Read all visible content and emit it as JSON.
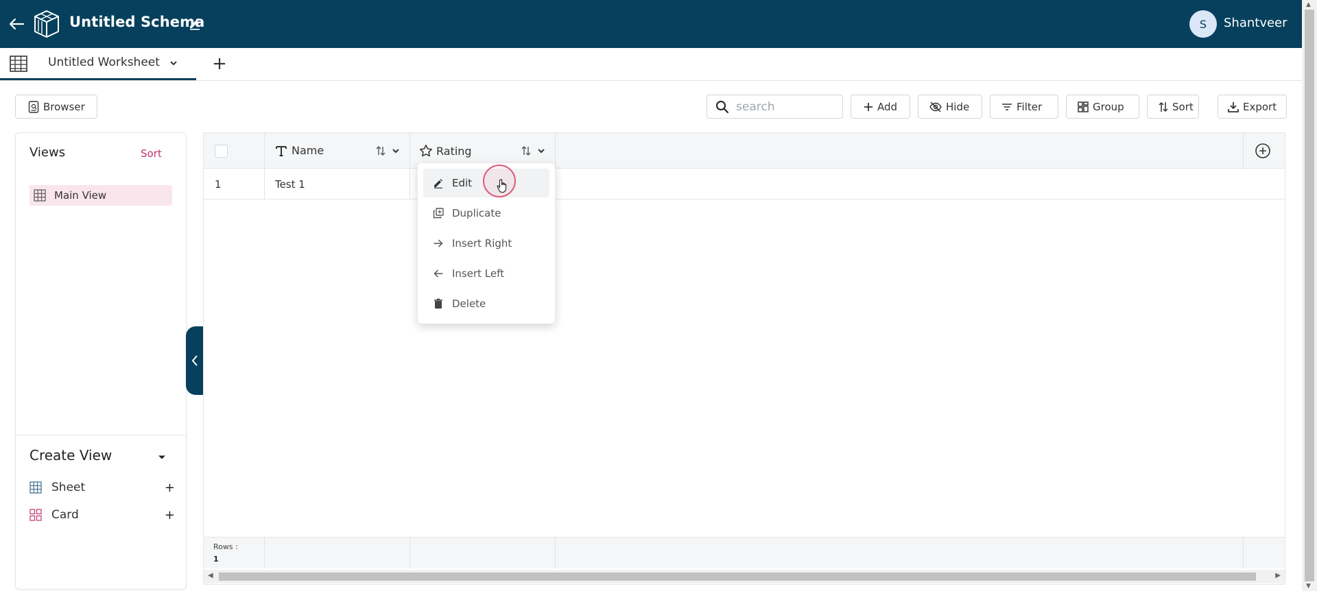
{
  "header": {
    "title": "Untitled Schema",
    "user_initial": "S",
    "user_name": "Shantveer"
  },
  "tabs": [
    {
      "label": "Untitled Worksheet"
    }
  ],
  "toolbar": {
    "browser_label": "Browser",
    "search_placeholder": "search",
    "add_label": "Add",
    "hide_label": "Hide",
    "filter_label": "Filter",
    "group_label": "Group",
    "sort_label": "Sort",
    "export_label": "Export"
  },
  "views_panel": {
    "title": "Views",
    "sort_label": "Sort",
    "items": [
      {
        "label": "Main View"
      }
    ],
    "create_view_title": "Create View",
    "create_options": [
      {
        "label": "Sheet",
        "icon": "grid-icon"
      },
      {
        "label": "Card",
        "icon": "cards-icon"
      }
    ]
  },
  "grid": {
    "columns": [
      {
        "label": "Name",
        "icon": "text-type-icon"
      },
      {
        "label": "Rating",
        "icon": "star-icon"
      }
    ],
    "rows": [
      {
        "num": "1",
        "name": "Test 1"
      }
    ],
    "footer_label": "Rows :",
    "footer_value": "1"
  },
  "context_menu": {
    "items": [
      {
        "label": "Edit",
        "icon": "pencil-icon"
      },
      {
        "label": "Duplicate",
        "icon": "duplicate-icon"
      },
      {
        "label": "Insert Right",
        "icon": "arrow-right-icon"
      },
      {
        "label": "Insert Left",
        "icon": "arrow-left-icon"
      },
      {
        "label": "Delete",
        "icon": "trash-icon"
      }
    ]
  },
  "colors": {
    "header_bg": "#06405c",
    "accent_pink": "#c2336b",
    "selected_view_bg": "#f9e6ec"
  }
}
